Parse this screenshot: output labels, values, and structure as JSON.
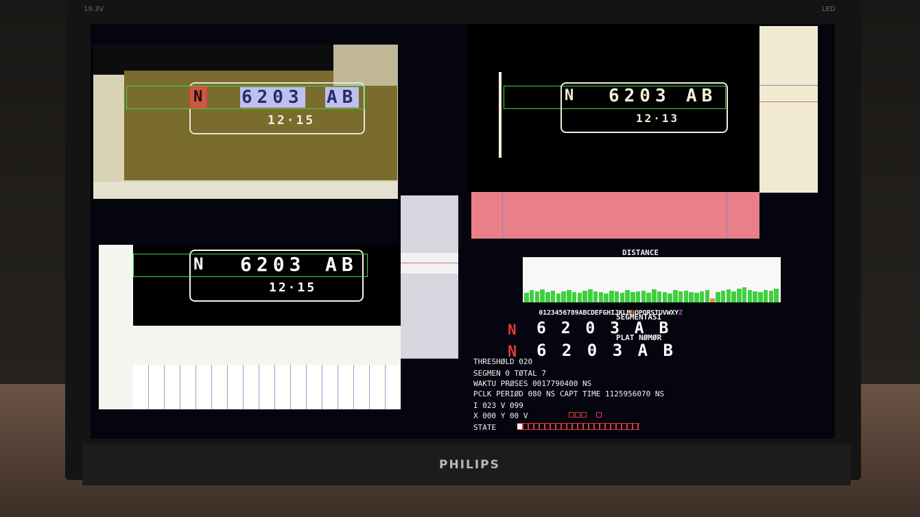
{
  "monitor": {
    "model_text": "19.3V",
    "led_text": "LED",
    "brand": "PHILIPS"
  },
  "plates": {
    "top_left": {
      "letter": "N",
      "number": "6203",
      "suffix": "AB",
      "sub": "12·15"
    },
    "top_right": {
      "letter": "N",
      "number": "6203",
      "suffix": "AB",
      "sub": "12·13"
    },
    "mid_left": {
      "letter": "N",
      "number": "6203",
      "suffix": "AB",
      "sub": "12·15"
    }
  },
  "distance": {
    "title": "DISTANCE",
    "chars_main": "0123456789ABCDEFGHIJKLM",
    "char_hl": "N",
    "chars_rest": "OPQRSTUVWXY",
    "char_last": "Z",
    "bars": [
      14,
      18,
      16,
      19,
      15,
      17,
      13,
      16,
      18,
      15,
      14,
      17,
      19,
      16,
      15,
      13,
      17,
      16,
      14,
      18,
      15,
      16,
      17,
      14,
      19,
      16,
      15,
      13,
      18,
      16,
      17,
      15,
      14,
      16,
      18,
      6,
      15,
      17,
      19,
      16,
      20,
      22,
      18,
      16,
      15,
      18,
      17,
      20
    ]
  },
  "segmentasi": {
    "title": "SEGMENTASI",
    "first": "N",
    "rest": "6 2 0 3 A B"
  },
  "plat_nomor": {
    "title": "PLAT NØMØR",
    "first": "N",
    "rest": "6 2 0 3 A B"
  },
  "status": {
    "threshold": "THRESHØLD 020",
    "segmen": "SEGMEN 0 TØTAL 7",
    "waktu": "WAKTU PRØSES 0017790400 NS",
    "pclk": "PCLK PERIØD 080 NS CAPT TIME 1125956070 NS",
    "iv": "I 023 V 099",
    "xy": "X 000 Y 00 V",
    "state": "STATE"
  },
  "colors": {
    "accent_green": "#3fd040",
    "accent_red": "#e03a3a",
    "panel_pink": "#e97f88"
  }
}
